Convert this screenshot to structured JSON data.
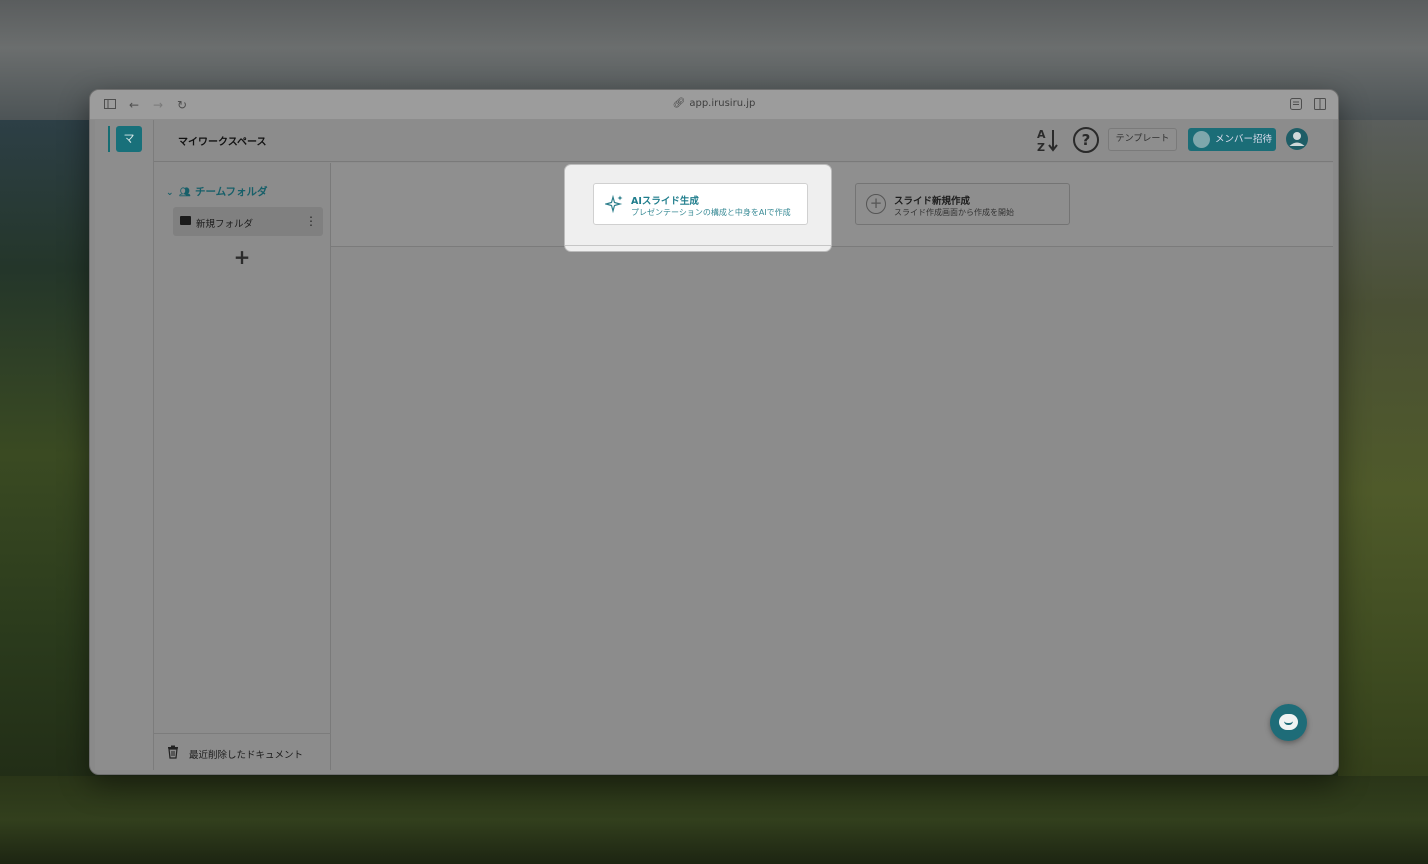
{
  "browser": {
    "url": "app.irusiru.jp",
    "icons": [
      "sidebar-toggle-icon",
      "back-arrow-icon",
      "forward-arrow-icon",
      "reload-icon",
      "link-icon",
      "reader-icon",
      "split-view-icon"
    ]
  },
  "rail": {
    "workspace_initial": "マ"
  },
  "header": {
    "workspace_title": "マイワークスペース",
    "template_label": "テンプレート",
    "invite_label": "メンバー招待"
  },
  "sidebar": {
    "team_folder_label": "チームフォルダ",
    "folders": [
      {
        "label": "新規フォルダ"
      }
    ],
    "add_label": "+",
    "trash_label": "最近削除したドキュメント"
  },
  "main": {
    "ai_card": {
      "title": "AIスライド生成",
      "subtitle": "プレゼンテーションの構成と中身をAIで作成"
    },
    "new_card": {
      "title": "スライド新規作成",
      "subtitle": "スライド作成画面から作成を開始"
    }
  },
  "colors": {
    "brand": "#1b6d77",
    "ai_accent": "#1f7d8c"
  }
}
